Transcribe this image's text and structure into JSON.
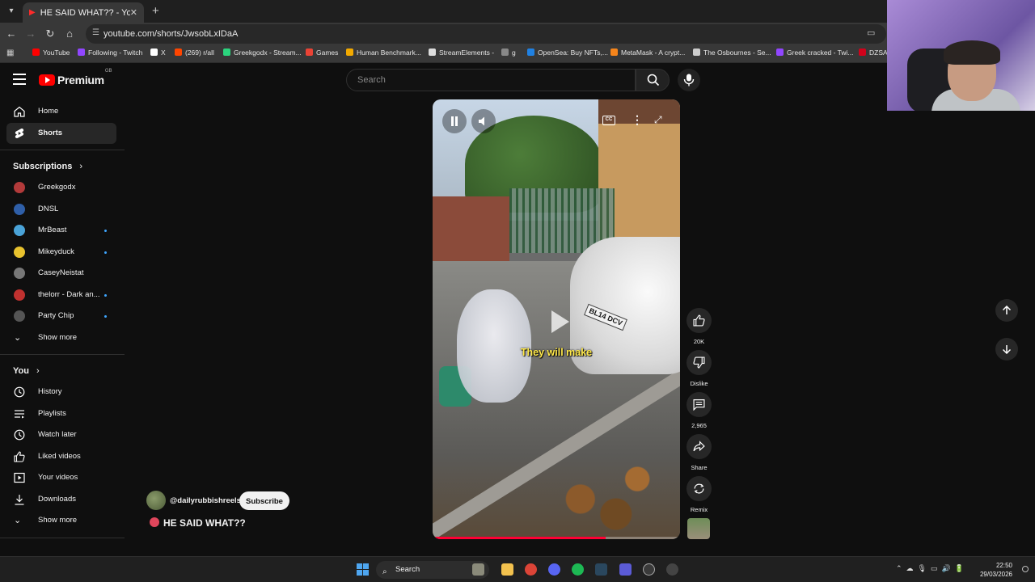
{
  "browser": {
    "tab_title": "HE SAID WHAT?? - YouTube",
    "url": "youtube.com/shorts/JwsobLxIDaA",
    "bookmarks": [
      {
        "label": "YouTube",
        "color": "#ff0000"
      },
      {
        "label": "Following - Twitch",
        "color": "#9146ff"
      },
      {
        "label": "X",
        "color": "#ffffff"
      },
      {
        "label": "(269) r/all",
        "color": "#ff4500"
      },
      {
        "label": "Greekgodx - Stream...",
        "color": "#2bd47d"
      },
      {
        "label": "Games",
        "color": "#ea4335"
      },
      {
        "label": "Human Benchmark...",
        "color": "#f2a900"
      },
      {
        "label": "StreamElements -",
        "color": "#dddddd"
      },
      {
        "label": "g",
        "color": "#888888"
      },
      {
        "label": "OpenSea: Buy NFTs,...",
        "color": "#2081e2"
      },
      {
        "label": "MetaMask - A crypt...",
        "color": "#f6851b"
      },
      {
        "label": "The Osbournes - Se...",
        "color": "#cccccc"
      },
      {
        "label": "Greek cracked - Twi...",
        "color": "#9146ff"
      },
      {
        "label": "DZSAL",
        "color": "#d0021b"
      }
    ]
  },
  "youtube": {
    "logo_text": "Premium",
    "logo_region": "GB",
    "search_placeholder": "Search",
    "accent_color": "#ff0000"
  },
  "sidebar": {
    "main": [
      {
        "label": "Home",
        "icon": "home-icon"
      },
      {
        "label": "Shorts",
        "icon": "shorts-icon",
        "active": true
      }
    ],
    "subscriptions_title": "Subscriptions",
    "subscriptions": [
      {
        "label": "Greekgodx",
        "color": "#b23a3a",
        "new": false
      },
      {
        "label": "DNSL",
        "color": "#2f5fa8",
        "new": false
      },
      {
        "label": "MrBeast",
        "color": "#4aa3d8",
        "new": true
      },
      {
        "label": "Mikeyduck",
        "color": "#e8c22e",
        "new": true
      },
      {
        "label": "CaseyNeistat",
        "color": "#777777",
        "new": false
      },
      {
        "label": "thelorr - Dark an...",
        "color": "#c0312f",
        "new": true
      },
      {
        "label": "Party Chip",
        "color": "#555555",
        "new": true
      }
    ],
    "subs_show_more": "Show more",
    "you_title": "You",
    "you_items": [
      {
        "label": "History",
        "icon": "history-icon"
      },
      {
        "label": "Playlists",
        "icon": "playlists-icon"
      },
      {
        "label": "Watch later",
        "icon": "watch-later-icon"
      },
      {
        "label": "Liked videos",
        "icon": "liked-icon"
      },
      {
        "label": "Your videos",
        "icon": "your-videos-icon"
      },
      {
        "label": "Downloads",
        "icon": "download-icon"
      }
    ],
    "you_show_more": "Show more"
  },
  "video": {
    "subtitle": "They will make",
    "plate": "BL14 DCV",
    "cc_label": "CC",
    "progress": 0.7
  },
  "actions": {
    "like_count": "20K",
    "dislike_label": "Dislike",
    "comment_count": "2,965",
    "share_label": "Share",
    "remix_label": "Remix"
  },
  "channel": {
    "handle": "@dailyrubbishreels",
    "subscribe_label": "Subscribe",
    "title": "HE SAID WHAT??"
  },
  "taskbar": {
    "search_label": "Search",
    "time": "22:50",
    "date": "29/03/2026"
  }
}
